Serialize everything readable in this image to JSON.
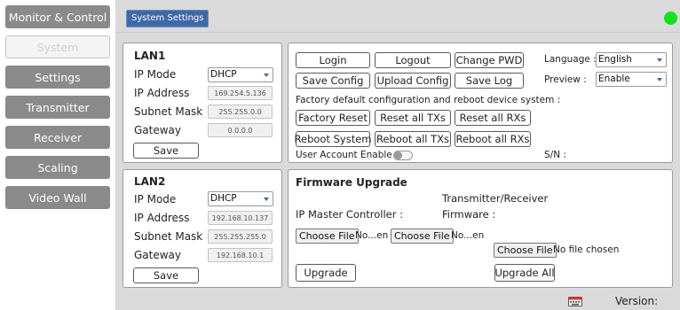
{
  "sidebar": {
    "items": [
      {
        "label": "Monitor & Control"
      },
      {
        "label": "System"
      },
      {
        "label": "Settings"
      },
      {
        "label": "Transmitter"
      },
      {
        "label": "Receiver"
      },
      {
        "label": "Scaling"
      },
      {
        "label": "Video Wall"
      }
    ],
    "active_index": 1
  },
  "header": {
    "title": "System Settings",
    "status_color": "#12e21a"
  },
  "lan1": {
    "title": "LAN1",
    "ip_mode_label": "IP Mode",
    "ip_mode_value": "DHCP",
    "ip_address_label": "IP Address",
    "ip_address_value": "169.254.5.136",
    "subnet_label": "Subnet Mask",
    "subnet_value": "255.255.0.0",
    "gateway_label": "Gateway",
    "gateway_value": "0.0.0.0",
    "save_label": "Save"
  },
  "lan2": {
    "title": "LAN2",
    "ip_mode_label": "IP Mode",
    "ip_mode_value": "DHCP",
    "ip_address_label": "IP Address",
    "ip_address_value": "192.168.10.137",
    "subnet_label": "Subnet Mask",
    "subnet_value": "255.255.255.0",
    "gateway_label": "Gateway",
    "gateway_value": "192.168.10.1",
    "save_label": "Save"
  },
  "system": {
    "login": "Login",
    "logout": "Logout",
    "change_pwd": "Change PWD",
    "save_config": "Save Config",
    "upload_config": "Upload Config",
    "save_log": "Save Log",
    "factory_text": "Factory default configuration and reboot device system :",
    "factory_reset": "Factory Reset",
    "reset_txs": "Reset all TXs",
    "reset_rxs": "Reset all RXs",
    "reboot_system": "Reboot System",
    "reboot_txs": "Reboot all TXs",
    "reboot_rxs": "Reboot all RXs",
    "user_account_label": "User Account Enable :",
    "language_label": "Language :",
    "language_value": "English",
    "preview_label": "Preview :",
    "preview_value": "Enable",
    "sn_label": "S/N :"
  },
  "firmware": {
    "title": "Firmware Upgrade",
    "tr_label": "Transmitter/Receiver",
    "master_label": "IP Master Controller :",
    "firmware_label": "Firmware :",
    "choose_file": "Choose File",
    "file1_status": "No...en",
    "file2_status": "No...en",
    "file3_status": "No file chosen",
    "upgrade": "Upgrade",
    "upgrade_all": "Upgrade All"
  },
  "footer": {
    "version_label": "Version:",
    "icon": "keyboard-icon"
  }
}
